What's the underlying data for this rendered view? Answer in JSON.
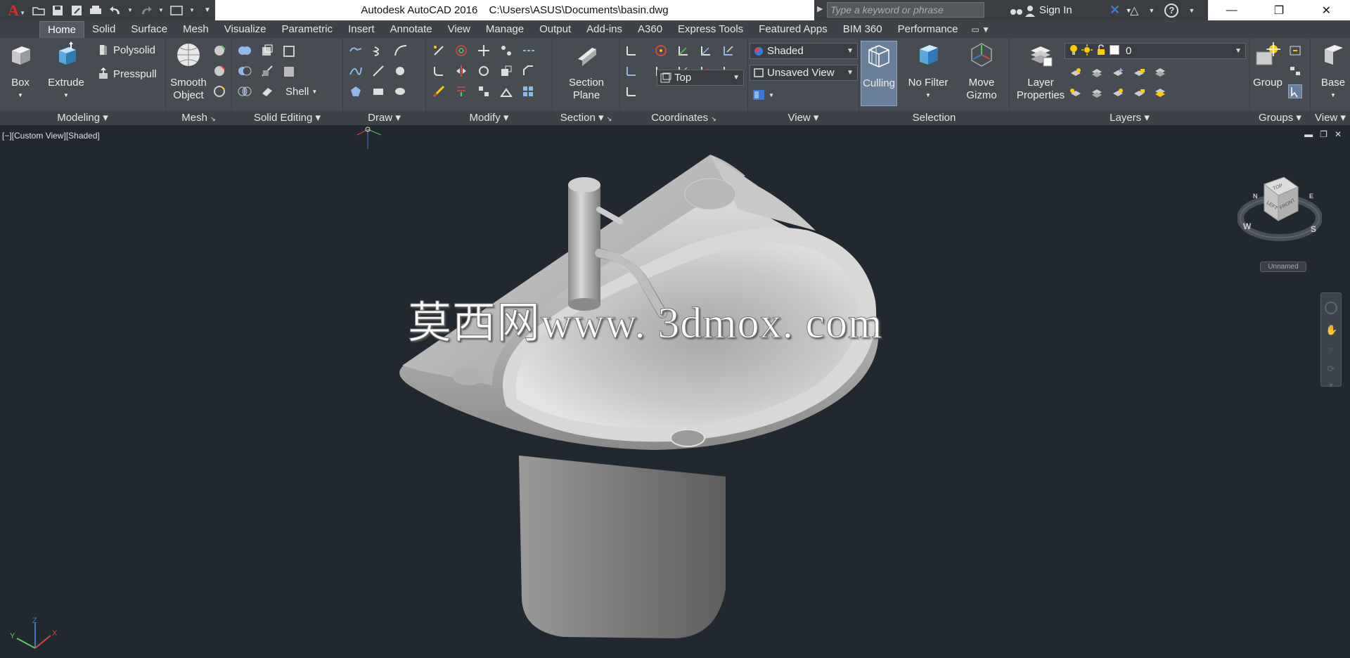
{
  "app": {
    "title": "Autodesk AutoCAD 2016",
    "file_path": "C:\\Users\\ASUS\\Documents\\basin.dwg"
  },
  "search": {
    "placeholder": "Type a keyword or phrase"
  },
  "account": {
    "sign_in": "Sign In"
  },
  "tabs": [
    "Home",
    "Solid",
    "Surface",
    "Mesh",
    "Visualize",
    "Parametric",
    "Insert",
    "Annotate",
    "View",
    "Manage",
    "Output",
    "Add-ins",
    "A360",
    "Express Tools",
    "Featured Apps",
    "BIM 360",
    "Performance"
  ],
  "active_tab": "Home",
  "ribbon": {
    "modeling": {
      "label": "Modeling",
      "box": "Box",
      "extrude": "Extrude",
      "polysolid": "Polysolid",
      "presspull": "Presspull"
    },
    "mesh": {
      "label": "Mesh",
      "smooth_line1": "Smooth",
      "smooth_line2": "Object"
    },
    "solid_editing": {
      "label": "Solid Editing",
      "shell": "Shell"
    },
    "draw": {
      "label": "Draw"
    },
    "modify": {
      "label": "Modify"
    },
    "section": {
      "label": "Section",
      "plane_line1": "Section",
      "plane_line2": "Plane"
    },
    "coordinates": {
      "label": "Coordinates",
      "view_select": "Top"
    },
    "view": {
      "label": "View",
      "visual_style": "Shaded",
      "named_view": "Unsaved View"
    },
    "selection": {
      "label": "Selection",
      "culling": "Culling",
      "no_filter_line1": "No Filter",
      "move_gizmo_line1": "Move",
      "move_gizmo_line2": "Gizmo"
    },
    "layers": {
      "label": "Layers",
      "layer_props_line1": "Layer",
      "layer_props_line2": "Properties",
      "current_layer": "0"
    },
    "groups": {
      "label": "Groups",
      "group": "Group"
    },
    "view2": {
      "label": "View",
      "base": "Base"
    }
  },
  "viewport": {
    "label": "[−][Custom View][Shaded]",
    "watermark": "莫西网www. 3dmox. com",
    "viewcube_label": "Unnamed",
    "compass": {
      "n": "N",
      "w": "W",
      "s": "S",
      "e": "E"
    },
    "cube_faces": {
      "top": "TOP",
      "left": "LEFT",
      "front": "FRONT"
    }
  },
  "colors": {
    "ribbon_bg": "#474c53",
    "drawing_bg": "#212830",
    "autocad_red": "#e8262c",
    "active_button": "#6a7f99"
  }
}
